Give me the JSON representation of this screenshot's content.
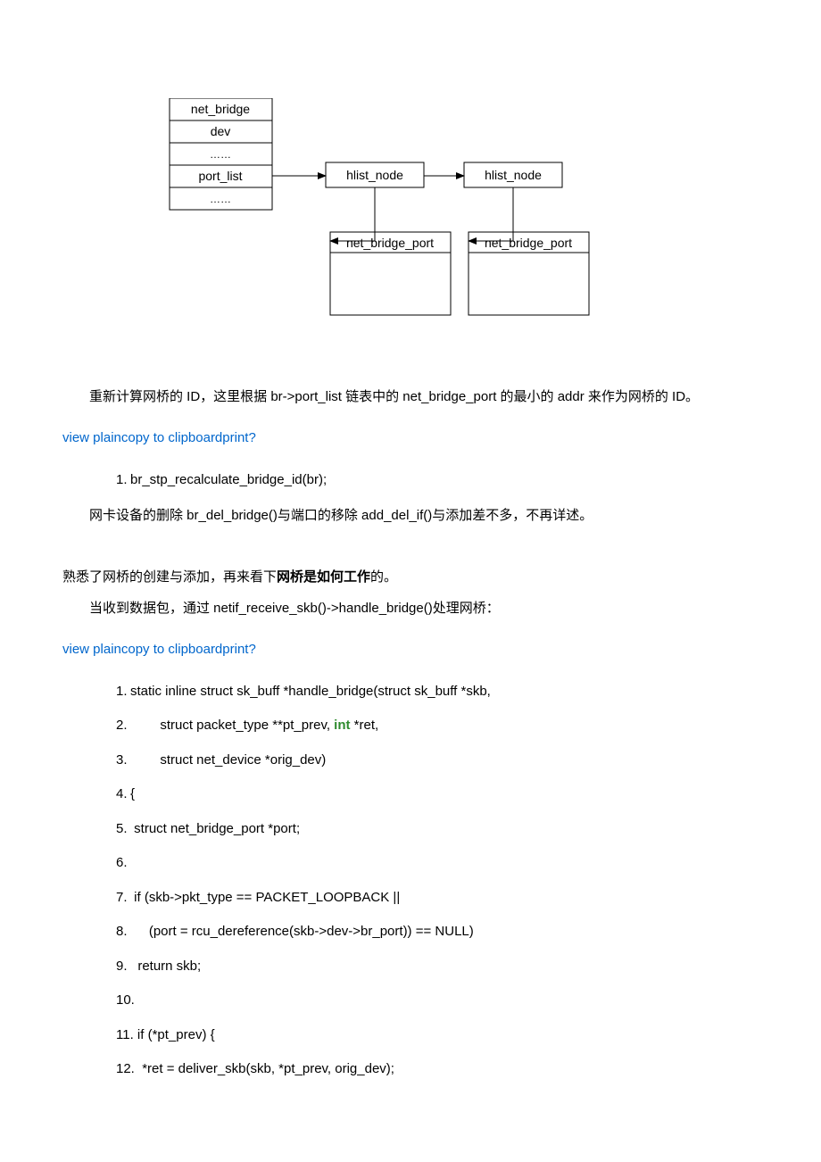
{
  "diagram": {
    "box_net_bridge": "net_bridge",
    "row_dev": "dev",
    "row_dots1": "……",
    "row_port_list": "port_list",
    "row_dots2": "……",
    "hlist1": "hlist_node",
    "hlist2": "hlist_node",
    "nbp1": "net_bridge_port",
    "nbp2": "net_bridge_port"
  },
  "para1": "重新计算网桥的 ID，这里根据 br->port_list 链表中的 net_bridge_port 的最小的 addr 来作为网桥的 ID。",
  "linktext": {
    "view": "view plain",
    "copy": "copy to clipboard",
    "print": "print",
    "q": "?"
  },
  "code1": {
    "l1": "br_stp_recalculate_bridge_id(br);  "
  },
  "para2": "网卡设备的删除 br_del_bridge()与端口的移除 add_del_if()与添加差不多，不再详述。",
  "para3a": "熟悉了网桥的创建与添加，再来看下",
  "para3b": "网桥是如何工作",
  "para3c": "的。",
  "para4": "当收到数据包，通过 netif_receive_skb()->handle_bridge()处理网桥：",
  "code2": {
    "l1": "static inline struct sk_buff *handle_bridge(struct sk_buff *skb,  ",
    "l2a": "        struct packet_type **pt_prev, ",
    "l2b": "int",
    "l2c": " *ret,  ",
    "l3": "        struct net_device *orig_dev)  ",
    "l4": "{  ",
    "l5": " struct net_bridge_port *port;  ",
    "l6": "  ",
    "l7": " if (skb->pkt_type == PACKET_LOOPBACK ||  ",
    "l8": "     (port = rcu_dereference(skb->dev->br_port)) == NULL)  ",
    "l9": "  return skb;  ",
    "l10": "  ",
    "l11": " if (*pt_prev) {  ",
    "l12": "  *ret = deliver_skb(skb, *pt_prev, orig_dev);  "
  }
}
